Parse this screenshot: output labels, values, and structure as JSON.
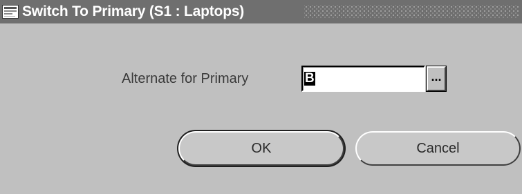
{
  "window": {
    "title": "Switch To Primary (S1 : Laptops)",
    "app_icon": "oracle-app-icon"
  },
  "form": {
    "alternate_label": "Alternate for Primary",
    "alternate_value": "B",
    "lov_button_label": "..."
  },
  "buttons": {
    "ok_label": "OK",
    "cancel_label": "Cancel"
  },
  "colors": {
    "background": "#c0c0c0",
    "titlebar": "#6f6f6f",
    "title_text": "#ffffff"
  }
}
